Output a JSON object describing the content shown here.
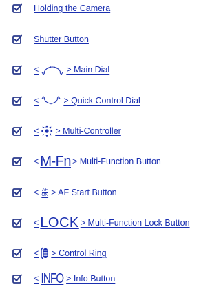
{
  "items": [
    {
      "text": "Holding the Camera"
    },
    {
      "text": "Shutter Button"
    },
    {
      "prefix": "<",
      "icon": "main-dial-icon",
      "text": "> Main Dial"
    },
    {
      "prefix": "<",
      "icon": "quick-control-dial-icon",
      "text": "> Quick Control Dial"
    },
    {
      "prefix": "<",
      "icon": "multi-controller-icon",
      "text": "> Multi-Controller"
    },
    {
      "prefix": "<",
      "symbol": "M-Fn",
      "text": "> Multi-Function Button"
    },
    {
      "prefix": "<",
      "symbol_top": "AF",
      "symbol_bottom": "ON",
      "text": "> AF Start Button"
    },
    {
      "prefix": "<",
      "symbol": "LOCK",
      "text": "> Multi-Function Lock Button"
    },
    {
      "prefix": "<",
      "icon": "control-ring-icon",
      "text": "> Control Ring"
    },
    {
      "prefix": "<",
      "symbol": "INFO",
      "text": "> Info Button"
    }
  ],
  "colors": {
    "link": "#1a2fb0",
    "checkbox": "#2a3a8c"
  }
}
